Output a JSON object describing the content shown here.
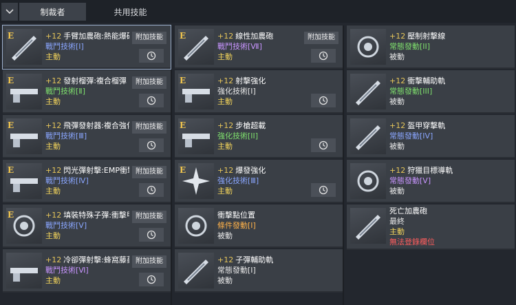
{
  "tabs": [
    {
      "label": "制裁者",
      "active": true
    },
    {
      "label": "共用技能",
      "active": false
    }
  ],
  "addon_label": "附加技能",
  "columns": [
    [
      {
        "level": "+12",
        "name": "手臂加農砲:熱能爆破",
        "cat": "戰鬥技術[Ⅰ]",
        "catColor": "blue",
        "role": "主動",
        "roleColor": "yellow",
        "badge": "E",
        "addon": true,
        "cooldown": true,
        "selected": true,
        "icon": "arm-cannon-icon"
      },
      {
        "level": "+12",
        "name": "發射榴彈:複合榴彈",
        "cat": "戰鬥技術[Ⅱ]",
        "catColor": "green",
        "role": "主動",
        "roleColor": "yellow",
        "badge": "E",
        "addon": true,
        "cooldown": true,
        "icon": "grenade-launcher-icon"
      },
      {
        "level": "+12",
        "name": "飛彈發射器:複合強化",
        "cat": "戰鬥技術[Ⅲ]",
        "catColor": "blue",
        "role": "主動",
        "roleColor": "yellow",
        "badge": "E",
        "addon": true,
        "cooldown": true,
        "icon": "missile-launcher-icon"
      },
      {
        "level": "+12",
        "name": "閃光彈射擊:EMP衝擊",
        "cat": "戰鬥技術[Ⅳ]",
        "catColor": "blue",
        "role": "主動",
        "roleColor": "yellow",
        "badge": "E",
        "addon": true,
        "cooldown": true,
        "icon": "flash-shot-icon"
      },
      {
        "level": "+12",
        "name": "填裝特殊子彈:衝擊甲",
        "cat": "戰鬥技術[Ⅴ]",
        "catColor": "blue",
        "role": "主動",
        "roleColor": "yellow",
        "badge": "E",
        "addon": true,
        "cooldown": true,
        "icon": "special-ammo-icon"
      },
      {
        "level": "+12",
        "name": "冷卻彈射擊:蜂窩藤蔓",
        "cat": "戰鬥技術[Ⅵ]",
        "catColor": "purple",
        "role": "主動",
        "roleColor": "yellow",
        "badge": "",
        "addon": true,
        "cooldown": true,
        "icon": "cooling-shot-icon"
      }
    ],
    [
      {
        "level": "+12",
        "name": "線性加農砲",
        "cat": "戰鬥技術[Ⅶ]",
        "catColor": "purple",
        "role": "主動",
        "roleColor": "yellow",
        "badge": "E",
        "addon": true,
        "cooldown": true,
        "icon": "linear-cannon-icon"
      },
      {
        "level": "+12",
        "name": "射擊強化",
        "cat": "強化技術[I]",
        "catColor": "white",
        "role": "主動",
        "roleColor": "yellow",
        "badge": "E",
        "addon": false,
        "cooldown": true,
        "icon": "shot-enhance-icon"
      },
      {
        "level": "+12",
        "name": "步槍超載",
        "cat": "強化技術[II]",
        "catColor": "green",
        "role": "主動",
        "roleColor": "yellow",
        "badge": "E",
        "addon": false,
        "cooldown": true,
        "icon": "rifle-overload-icon"
      },
      {
        "level": "+12",
        "name": "爆發強化",
        "cat": "強化技術[Ⅲ]",
        "catColor": "blue",
        "role": "主動",
        "roleColor": "yellow",
        "badge": "E",
        "addon": false,
        "cooldown": true,
        "icon": "burst-enhance-icon"
      },
      {
        "level": "",
        "name": "衝擊點位置",
        "cat": "條件發動[Ⅰ]",
        "catColor": "orange",
        "role": "被動",
        "roleColor": "white",
        "badge": "",
        "addon": false,
        "cooldown": false,
        "icon": "impact-point-icon"
      },
      {
        "level": "+12",
        "name": "子彈輔助軌",
        "cat": "常態發動[I]",
        "catColor": "white",
        "role": "被動",
        "roleColor": "white",
        "badge": "",
        "addon": false,
        "cooldown": false,
        "icon": "bullet-rail-icon"
      }
    ],
    [
      {
        "level": "+12",
        "name": "壓制射擊線",
        "cat": "常態發動[II]",
        "catColor": "green",
        "role": "被動",
        "roleColor": "white",
        "badge": "",
        "addon": false,
        "cooldown": false,
        "icon": "suppress-line-icon"
      },
      {
        "level": "+12",
        "name": "衝擊輔助軌",
        "cat": "常態發動[III]",
        "catColor": "green",
        "role": "被動",
        "roleColor": "white",
        "badge": "",
        "addon": false,
        "cooldown": false,
        "icon": "impact-rail-icon"
      },
      {
        "level": "+12",
        "name": "盔甲穿擊軌",
        "cat": "常態發動[IV]",
        "catColor": "blue",
        "role": "被動",
        "roleColor": "white",
        "badge": "",
        "addon": false,
        "cooldown": false,
        "icon": "armor-pierce-icon"
      },
      {
        "level": "+12",
        "name": "狩獵目標導軌",
        "cat": "常態發動[Ⅴ]",
        "catColor": "purple",
        "role": "被動",
        "roleColor": "white",
        "badge": "",
        "addon": false,
        "cooldown": false,
        "icon": "hunt-target-icon"
      },
      {
        "level": "",
        "name": "死亡加農砲",
        "cat": "最終",
        "catColor": "white",
        "role": "主動",
        "roleColor": "yellow",
        "extra": "無法登錄欄位",
        "badge": "",
        "addon": false,
        "cooldown": false,
        "icon": "death-cannon-icon"
      }
    ]
  ]
}
